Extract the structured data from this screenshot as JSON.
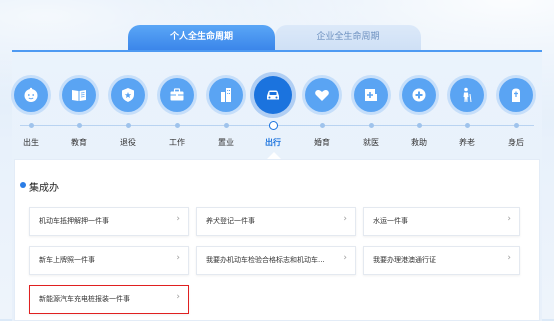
{
  "tabs": [
    {
      "label": "个人全生命周期",
      "active": true
    },
    {
      "label": "企业全生命周期",
      "active": false
    }
  ],
  "stages": [
    {
      "label": "出生",
      "icon": "baby-face-icon"
    },
    {
      "label": "教育",
      "icon": "book-icon"
    },
    {
      "label": "退役",
      "icon": "medal-shield-icon"
    },
    {
      "label": "工作",
      "icon": "briefcase-icon"
    },
    {
      "label": "置业",
      "icon": "building-icon"
    },
    {
      "label": "出行",
      "icon": "car-icon",
      "active": true
    },
    {
      "label": "婚育",
      "icon": "heart-icon"
    },
    {
      "label": "就医",
      "icon": "medical-kit-icon"
    },
    {
      "label": "救助",
      "icon": "cross-circle-icon"
    },
    {
      "label": "养老",
      "icon": "elderly-icon"
    },
    {
      "label": "身后",
      "icon": "tomb-icon"
    }
  ],
  "section": {
    "title": "集成办",
    "items": [
      {
        "label": "机动车抵押解押一件事"
      },
      {
        "label": "养犬登记一件事"
      },
      {
        "label": "水运一件事"
      },
      {
        "label": "新车上牌照一件事"
      },
      {
        "label": "我要办机动车检验合格标志和机动车..."
      },
      {
        "label": "我要办理港澳通行证"
      },
      {
        "label": "新能源汽车充电桩报装一件事",
        "highlighted": true
      }
    ],
    "arrow": "›"
  },
  "colors": {
    "accent": "#1b73de",
    "icon_bg": "#5aa4f3",
    "highlight_border": "#e02020"
  }
}
